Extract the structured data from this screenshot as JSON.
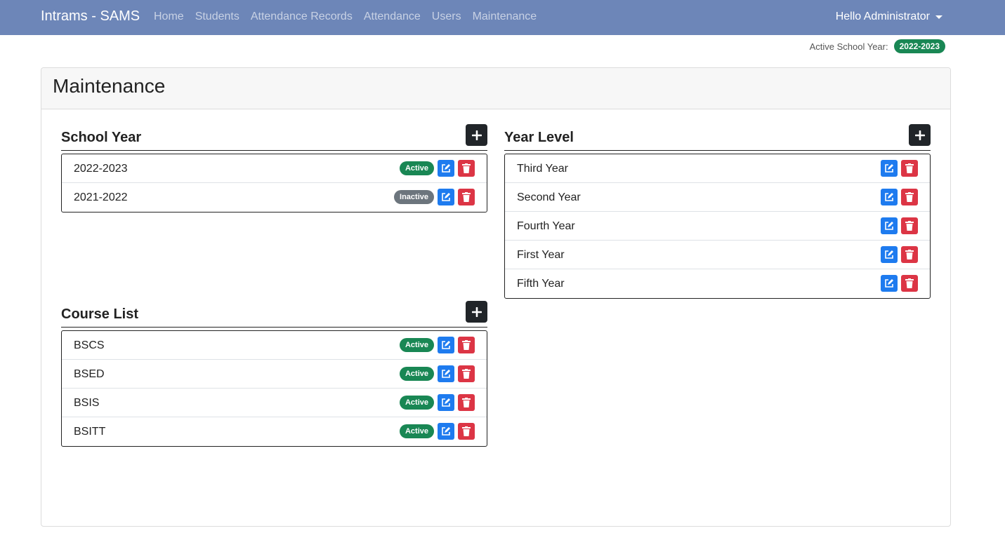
{
  "app": {
    "brand": "Intrams - SAMS"
  },
  "nav": {
    "links": [
      "Home",
      "Students",
      "Attendance Records",
      "Attendance",
      "Users",
      "Maintenance"
    ],
    "user_menu": "Hello Administrator"
  },
  "active_school_year": {
    "label": "Active School Year:",
    "value": "2022-2023"
  },
  "page": {
    "title": "Maintenance"
  },
  "school_year": {
    "title": "School Year",
    "items": [
      {
        "label": "2022-2023",
        "status": "Active"
      },
      {
        "label": "2021-2022",
        "status": "Inactive"
      }
    ]
  },
  "year_level": {
    "title": "Year Level",
    "items": [
      {
        "label": "Third Year"
      },
      {
        "label": "Second Year"
      },
      {
        "label": "Fourth Year"
      },
      {
        "label": "First Year"
      },
      {
        "label": "Fifth Year"
      }
    ]
  },
  "course_list": {
    "title": "Course List",
    "items": [
      {
        "label": "BSCS",
        "status": "Active"
      },
      {
        "label": "BSED",
        "status": "Active"
      },
      {
        "label": "BSIS",
        "status": "Active"
      },
      {
        "label": "BSITT",
        "status": "Active"
      }
    ]
  },
  "colors": {
    "navbar": "#6d86b8",
    "success": "#198754",
    "secondary": "#6c757d",
    "primary": "#1e7bef",
    "danger": "#dc3545",
    "dark": "#212529"
  },
  "icons": {
    "add": "plus-icon",
    "edit": "edit-icon",
    "delete": "trash-icon",
    "dropdown": "caret-down-icon"
  }
}
